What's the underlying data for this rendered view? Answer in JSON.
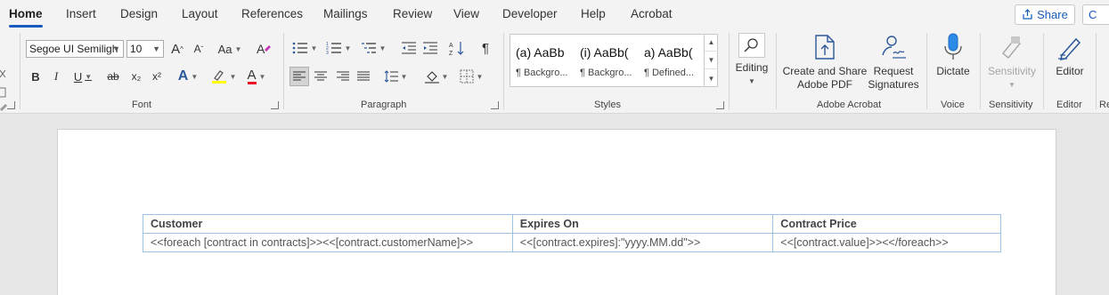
{
  "tabs": [
    {
      "label": "Home",
      "active": true
    },
    {
      "label": "Insert"
    },
    {
      "label": "Design"
    },
    {
      "label": "Layout"
    },
    {
      "label": "References"
    },
    {
      "label": "Mailings"
    },
    {
      "label": "Review"
    },
    {
      "label": "View"
    },
    {
      "label": "Developer"
    },
    {
      "label": "Help"
    },
    {
      "label": "Acrobat"
    }
  ],
  "share_label": "Share",
  "comments_label": "C",
  "font": {
    "name": "Segoe UI Semiligh",
    "size": "10",
    "group_label": "Font",
    "bold": "B",
    "italic": "I",
    "underline": "U",
    "strike": "ab",
    "subscript": "x₂",
    "superscript": "x²",
    "grow": "A",
    "shrink": "A",
    "case": "Aa",
    "effects": "A",
    "color": "A"
  },
  "paragraph": {
    "group_label": "Paragraph"
  },
  "styles": {
    "group_label": "Styles",
    "items": [
      {
        "preview": "(a)  AaBb",
        "name": "¶ Backgro..."
      },
      {
        "preview": "(i)  AaBb(",
        "name": "¶ Backgro..."
      },
      {
        "preview": "a)  AaBb(",
        "name": "¶ Defined..."
      }
    ]
  },
  "editing": {
    "label": "Editing"
  },
  "acrobat": {
    "group_label": "Adobe Acrobat",
    "create_share_line1": "Create and Share",
    "create_share_line2": "Adobe PDF",
    "request_line1": "Request",
    "request_line2": "Signatures"
  },
  "voice": {
    "group_label": "Voice",
    "dictate": "Dictate"
  },
  "sensitivity": {
    "group_label": "Sensitivity",
    "button": "Sensitivity"
  },
  "editor": {
    "group_label": "Editor",
    "button": "Editor"
  },
  "reuse": {
    "group_label": "Re"
  },
  "colors": {
    "accent": "#185abd",
    "table_border": "#9cc2e5"
  },
  "table": {
    "headers": [
      "Customer",
      "Expires On",
      "Contract Price"
    ],
    "rows": [
      [
        "<<foreach [contract in contracts]>><<[contract.customerName]>>",
        "<<[contract.expires]:\"yyyy.MM.dd\">>",
        "<<[contract.value]>><</foreach>>"
      ]
    ]
  }
}
